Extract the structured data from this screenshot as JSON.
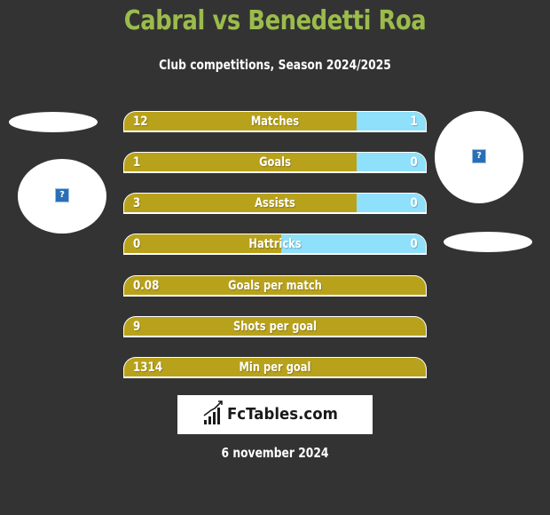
{
  "header": {
    "title": "Cabral vs Benedetti Roa",
    "subtitle": "Club competitions, Season 2024/2025"
  },
  "players": {
    "left": {
      "name": "Cabral",
      "photo_icon": "missing-image-icon"
    },
    "right": {
      "name": "Benedetti Roa",
      "photo_icon": "missing-image-icon"
    }
  },
  "colors": {
    "background": "#333333",
    "title": "#9bbb4c",
    "left_bar": "#b9a21b",
    "right_bar": "#8fe0fb"
  },
  "stats": [
    {
      "label": "Matches",
      "left": "12",
      "right": "1",
      "left_share": 0.77
    },
    {
      "label": "Goals",
      "left": "1",
      "right": "0",
      "left_share": 0.77
    },
    {
      "label": "Assists",
      "left": "3",
      "right": "0",
      "left_share": 0.77
    },
    {
      "label": "Hattricks",
      "left": "0",
      "right": "0",
      "left_share": 0.52
    },
    {
      "label": "Goals per match",
      "left": "0.08",
      "right": null,
      "left_share": 1.0
    },
    {
      "label": "Shots per goal",
      "left": "9",
      "right": null,
      "left_share": 1.0
    },
    {
      "label": "Min per goal",
      "left": "1314",
      "right": null,
      "left_share": 1.0
    }
  ],
  "footer": {
    "logo_text": "FcTables.com",
    "logo_icon": "bar-chart-growth-icon",
    "date": "6 november 2024"
  }
}
